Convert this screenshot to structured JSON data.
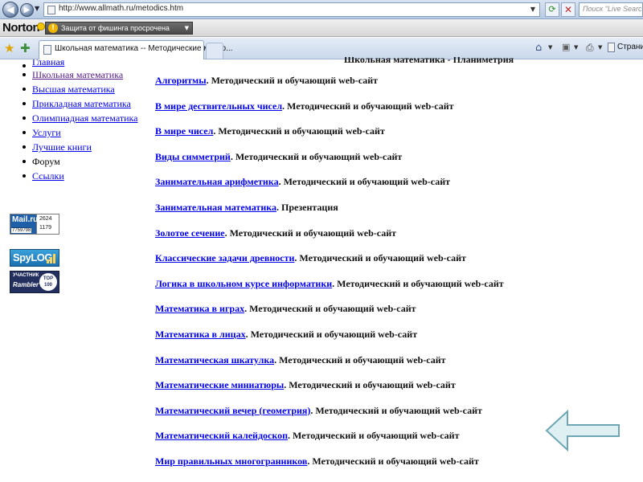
{
  "browser": {
    "url": "http://www.allmath.ru/metodics.htm",
    "search_placeholder": "Поиск \"Live Search\"",
    "norton_brand": "Norton",
    "phishing_status": "Защита от фишинга просрочена",
    "tab_title": "Школьная математика -- Методические матер...",
    "page_menu_label": "Страница"
  },
  "sidebar": {
    "menu": [
      {
        "label": "Главная",
        "style": "link"
      },
      {
        "label": "Школьная математика",
        "style": "visited"
      },
      {
        "label": "Высшая математика",
        "style": "link"
      },
      {
        "label": "Прикладная математика",
        "style": "link"
      },
      {
        "label": "Олимпиадная математика",
        "style": "link"
      },
      {
        "label": "Услуги",
        "style": "link"
      },
      {
        "label": "Лучшие книги",
        "style": "link"
      },
      {
        "label": "Форум",
        "style": "plain"
      },
      {
        "label": "Ссылки",
        "style": "link"
      }
    ],
    "counters": {
      "mail_logo": "Mail.ru",
      "mail_numbers": [
        "2624",
        "7759798",
        "1179"
      ],
      "spylog": "SpyLOG",
      "rambler_top": "УЧАСТНИК",
      "rambler_name": "Rambler's",
      "rambler_seal": "TOP 100"
    }
  },
  "main": {
    "heading": "Школьная математика - Планиметрия",
    "entries": [
      {
        "link": "Алгоритмы",
        "desc": ". Методический и обучающий web-сайт"
      },
      {
        "link": "В мире дествительных чисел",
        "desc": ". Методический и обучающий web-сайт"
      },
      {
        "link": "В мире чисел",
        "desc": ". Методический и обучающий web-сайт"
      },
      {
        "link": "Виды симметрий",
        "desc": ". Методический и обучающий web-сайт"
      },
      {
        "link": "Занимательная арифметика",
        "desc": ". Методический и обучающий web-сайт"
      },
      {
        "link": "Занимательная математика",
        "desc": ". Презентация"
      },
      {
        "link": "Золотое сечение",
        "desc": ". Методический и обучающий web-сайт"
      },
      {
        "link": "Классические задачи древности",
        "desc": ". Методический и обучающий web-сайт"
      },
      {
        "link": "Логика в школьном курсе информатики",
        "desc": ". Методический и обучающий web-сайт"
      },
      {
        "link": "Математика в играх",
        "desc": ". Методический и обучающий web-сайт"
      },
      {
        "link": "Математика в лицах",
        "desc": ". Методический и обучающий web-сайт"
      },
      {
        "link": "Математическая шкатулка",
        "desc": ". Методический и обучающий web-сайт"
      },
      {
        "link": "Математические миниатюры",
        "desc": ". Методический и обучающий web-сайт"
      },
      {
        "link": "Математический вечер (геометрия)",
        "desc": ". Методический и обучающий web-сайт"
      },
      {
        "link": "Математический калейдоскоп",
        "desc": ". Методический и обучающий web-сайт"
      },
      {
        "link": "Мир правильных многогранников",
        "desc": ". Методический и обучающий web-сайт"
      }
    ]
  },
  "colors": {
    "link": "#0000ee",
    "visited": "#551a8b",
    "arrow_fill": "#dff0f3",
    "arrow_stroke": "#6fa6b4"
  },
  "icons": {
    "back": "back-arrow-icon",
    "forward": "forward-arrow-icon",
    "refresh": "refresh-icon",
    "stop": "stop-icon",
    "favorites": "star-icon",
    "add_favorite": "add-favorite-icon",
    "home": "home-icon",
    "feeds": "rss-feed-icon",
    "print": "printer-icon",
    "page": "page-icon",
    "arrow": "left-arrow-icon"
  }
}
